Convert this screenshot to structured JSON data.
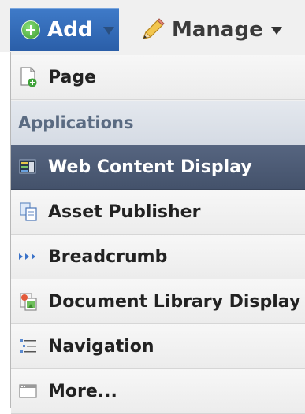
{
  "toolbar": {
    "add_label": "Add",
    "manage_label": "Manage"
  },
  "menu": {
    "page_label": "Page",
    "section_header": "Applications",
    "items": [
      {
        "label": "Web Content Display",
        "icon": "web-content-icon",
        "selected": true
      },
      {
        "label": "Asset Publisher",
        "icon": "asset-publisher-icon"
      },
      {
        "label": "Breadcrumb",
        "icon": "breadcrumb-icon"
      },
      {
        "label": "Document Library Display",
        "icon": "document-library-icon"
      },
      {
        "label": "Navigation",
        "icon": "navigation-icon"
      },
      {
        "label": "More...",
        "icon": "more-icon"
      }
    ]
  },
  "colors": {
    "add_button": "#2f6bbf",
    "selected_item": "#4d5b74",
    "section_header_text": "#5a6b82"
  }
}
